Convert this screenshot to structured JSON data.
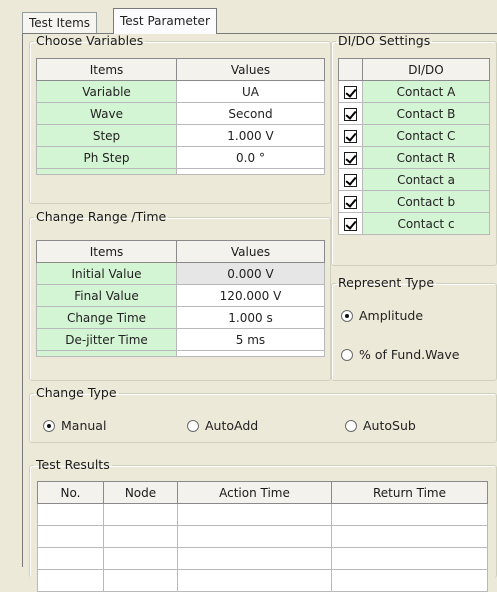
{
  "tabs": [
    {
      "label": "Test Items"
    },
    {
      "label": "Test Parameter"
    }
  ],
  "choose_variables": {
    "title": "Choose Variables",
    "headers": {
      "items": "Items",
      "values": "Values"
    },
    "rows": [
      {
        "label": "Variable",
        "value": "UA"
      },
      {
        "label": "Wave",
        "value": "Second"
      },
      {
        "label": "Step",
        "value": "1.000 V"
      },
      {
        "label": "Ph Step",
        "value": "0.0 °"
      }
    ]
  },
  "dido_settings": {
    "title": "DI/DO Settings",
    "header": "DI/DO",
    "rows": [
      {
        "label": "Contact A",
        "checked": true
      },
      {
        "label": "Contact B",
        "checked": true
      },
      {
        "label": "Contact C",
        "checked": true
      },
      {
        "label": "Contact R",
        "checked": true
      },
      {
        "label": "Contact a",
        "checked": true
      },
      {
        "label": "Contact b",
        "checked": true
      },
      {
        "label": "Contact c",
        "checked": true
      }
    ]
  },
  "change_range": {
    "title": "Change Range /Time",
    "headers": {
      "items": "Items",
      "values": "Values"
    },
    "rows": [
      {
        "label": "Initial Value",
        "value": "0.000 V"
      },
      {
        "label": "Final Value",
        "value": "120.000 V"
      },
      {
        "label": "Change Time",
        "value": "1.000 s"
      },
      {
        "label": "De-jitter Time",
        "value": "5 ms"
      }
    ]
  },
  "represent_type": {
    "title": "Represent Type",
    "options": [
      {
        "label": "Amplitude",
        "selected": true
      },
      {
        "label": "% of Fund.Wave",
        "selected": false
      }
    ]
  },
  "change_type": {
    "title": "Change Type",
    "options": [
      {
        "label": "Manual",
        "selected": true
      },
      {
        "label": "AutoAdd",
        "selected": false
      },
      {
        "label": "AutoSub",
        "selected": false
      }
    ]
  },
  "test_results": {
    "title": "Test Results",
    "headers": [
      "No.",
      "Node",
      "Action Time",
      "Return Time"
    ]
  }
}
